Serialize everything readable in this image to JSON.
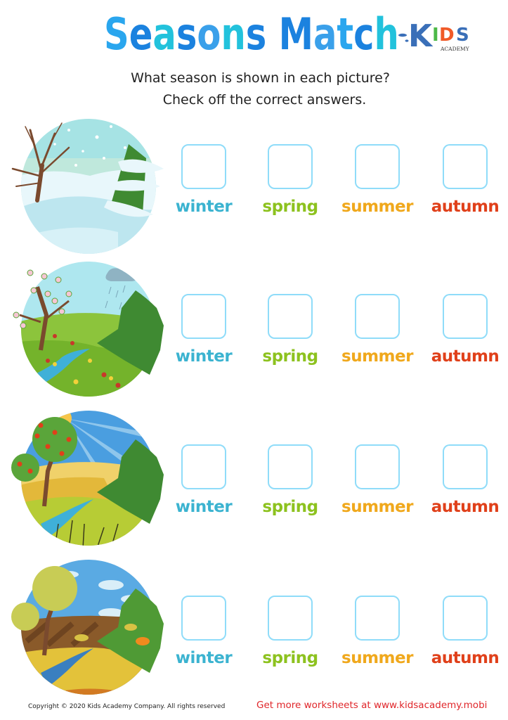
{
  "title": {
    "letters": [
      {
        "ch": "S",
        "color": "#2aa6ee"
      },
      {
        "ch": "e",
        "color": "#1b82df"
      },
      {
        "ch": "a",
        "color": "#22c2dc"
      },
      {
        "ch": "s",
        "color": "#1b82df"
      },
      {
        "ch": "o",
        "color": "#3aa0ea"
      },
      {
        "ch": "n",
        "color": "#22c2dc"
      },
      {
        "ch": "s",
        "color": "#1b82df"
      },
      {
        "ch": " ",
        "color": "#1b82df"
      },
      {
        "ch": "M",
        "color": "#1b82df"
      },
      {
        "ch": "a",
        "color": "#3aa0ea"
      },
      {
        "ch": "t",
        "color": "#2aa6ee"
      },
      {
        "ch": "c",
        "color": "#1b82df"
      },
      {
        "ch": "h",
        "color": "#22c2dc"
      }
    ],
    "text": "Seasons Match"
  },
  "logo": {
    "k": "K",
    "i": "I",
    "d": "D",
    "s": "S",
    "sub": "ACADEMY",
    "colors": {
      "k": "#3a6fb8",
      "i": "#4cb848",
      "d": "#f05a28",
      "s": "#3a6fb8"
    }
  },
  "instructions": {
    "line1": "What season is shown in each picture?",
    "line2": "Check off the correct answers."
  },
  "options": [
    {
      "label": "winter",
      "color": "#3bb3d0"
    },
    {
      "label": "spring",
      "color": "#8dc21f"
    },
    {
      "label": "summer",
      "color": "#f0a81c"
    },
    {
      "label": "autumn",
      "color": "#e0401a"
    }
  ],
  "rows": [
    {
      "scene": "winter-scene",
      "checked": [
        false,
        false,
        false,
        false
      ]
    },
    {
      "scene": "spring-scene",
      "checked": [
        false,
        false,
        false,
        false
      ]
    },
    {
      "scene": "summer-scene",
      "checked": [
        false,
        false,
        false,
        false
      ]
    },
    {
      "scene": "autumn-scene",
      "checked": [
        false,
        false,
        false,
        false
      ]
    }
  ],
  "footer": {
    "copyright": "Copyright © 2020 Kids Academy Company. All rights reserved",
    "promo": "Get more worksheets at www.kidsacademy.mobi"
  }
}
